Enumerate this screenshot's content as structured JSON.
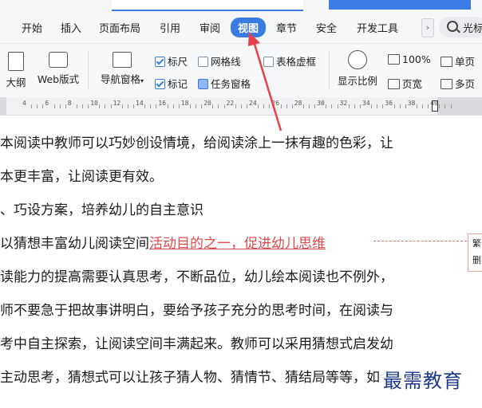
{
  "ribbon": {
    "tabs": [
      "开始",
      "插入",
      "页面布局",
      "引用",
      "审阅",
      "视图",
      "章节",
      "安全",
      "开发工具"
    ],
    "active_tab": "视图",
    "search_label": "光标"
  },
  "toolbar": {
    "outline": "大纲",
    "web_layout": "Web版式",
    "nav_pane": "导航窗格",
    "ruler": "标尺",
    "gridlines": "网格线",
    "table_gridlines": "表格虚框",
    "marks": "标记",
    "task_pane": "任务窗格",
    "display_ratio": "显示比例",
    "zoom_100": "100%",
    "page_width": "页宽",
    "single_page": "单页",
    "multi_page": "多页"
  },
  "ruler_numbers": [
    "4",
    "6",
    "8",
    "10",
    "12",
    "14",
    "16",
    "18",
    "20",
    "22",
    "24",
    "26",
    "28",
    "30",
    "32",
    "34",
    "36",
    "38",
    "40"
  ],
  "document": {
    "lines": [
      "本阅读中教师可以巧妙创设情境，给阅读涂上一抹有趣的色彩，让",
      "本更丰富，让阅读更有效。",
      "、巧设方案，培养幼儿的自主意识",
      "以猜想丰富幼儿阅读空间",
      "读能力的提高需要认真思考，不断品位，幼儿绘本阅读也不例外，",
      "师不要急于把故事讲明白，要给予孩子充分的思考时间，在阅读与",
      "考中自主探索，让阅读空间丰满起来。教师可以采用猜想式启发幼",
      "主动思考，猜想式可以让孩子猜人物、猜情节、猜结局等等，如今"
    ],
    "highlight": "活动目的之一，促进幼儿思维",
    "comment_chars": [
      "繁",
      "删"
    ]
  },
  "watermark": "最需教育",
  "colors": {
    "accent": "#3a7be0",
    "arrow": "#e8404a",
    "highlight": "#e04a4a"
  }
}
